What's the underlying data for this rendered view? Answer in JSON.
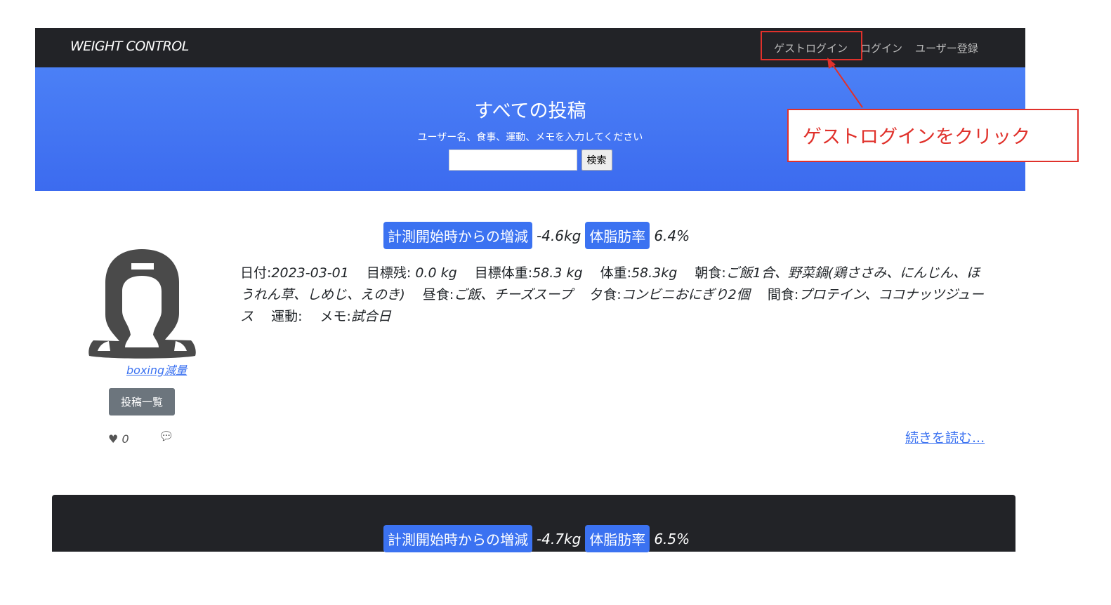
{
  "navbar": {
    "brand": "WEIGHT CONTROL",
    "links": [
      "ゲストログイン",
      "ログイン",
      "ユーザー登録"
    ]
  },
  "hero": {
    "title": "すべての投稿",
    "subtitle": "ユーザー名、食事、運動、メモを入力してください",
    "search_value": "",
    "search_button": "検索"
  },
  "annotation": {
    "text": "ゲストログインをクリック",
    "color": "#e0312b"
  },
  "posts": [
    {
      "change_label": "計測開始時からの増減",
      "change_value": "-4.6kg",
      "fat_label": "体脂肪率",
      "fat_value": "6.4%",
      "username": "boxing減量",
      "list_button": "投稿一覧",
      "likes": "0",
      "fields": [
        {
          "label": "日付:",
          "value": "2023-03-01"
        },
        {
          "label": "目標残:",
          "value": " 0.0 kg"
        },
        {
          "label": "目標体重:",
          "value": "58.3 kg"
        },
        {
          "label": "体重:",
          "value": "58.3kg"
        },
        {
          "label": "朝食:",
          "value": "ご飯1合、野菜鍋(鶏ささみ、にんじん、ほうれん草、しめじ、えのき)"
        },
        {
          "label": "昼食:",
          "value": "ご飯、チーズスープ"
        },
        {
          "label": "夕食:",
          "value": "コンビニおにぎり2個"
        },
        {
          "label": "間食:",
          "value": "プロテイン、ココナッツジュース"
        },
        {
          "label": "運動:",
          "value": ""
        },
        {
          "label": "メモ:",
          "value": "試合日"
        }
      ],
      "read_more": "続きを読む..."
    },
    {
      "change_label": "計測開始時からの増減",
      "change_value": "-4.7kg",
      "fat_label": "体脂肪率",
      "fat_value": "6.5%"
    }
  ]
}
